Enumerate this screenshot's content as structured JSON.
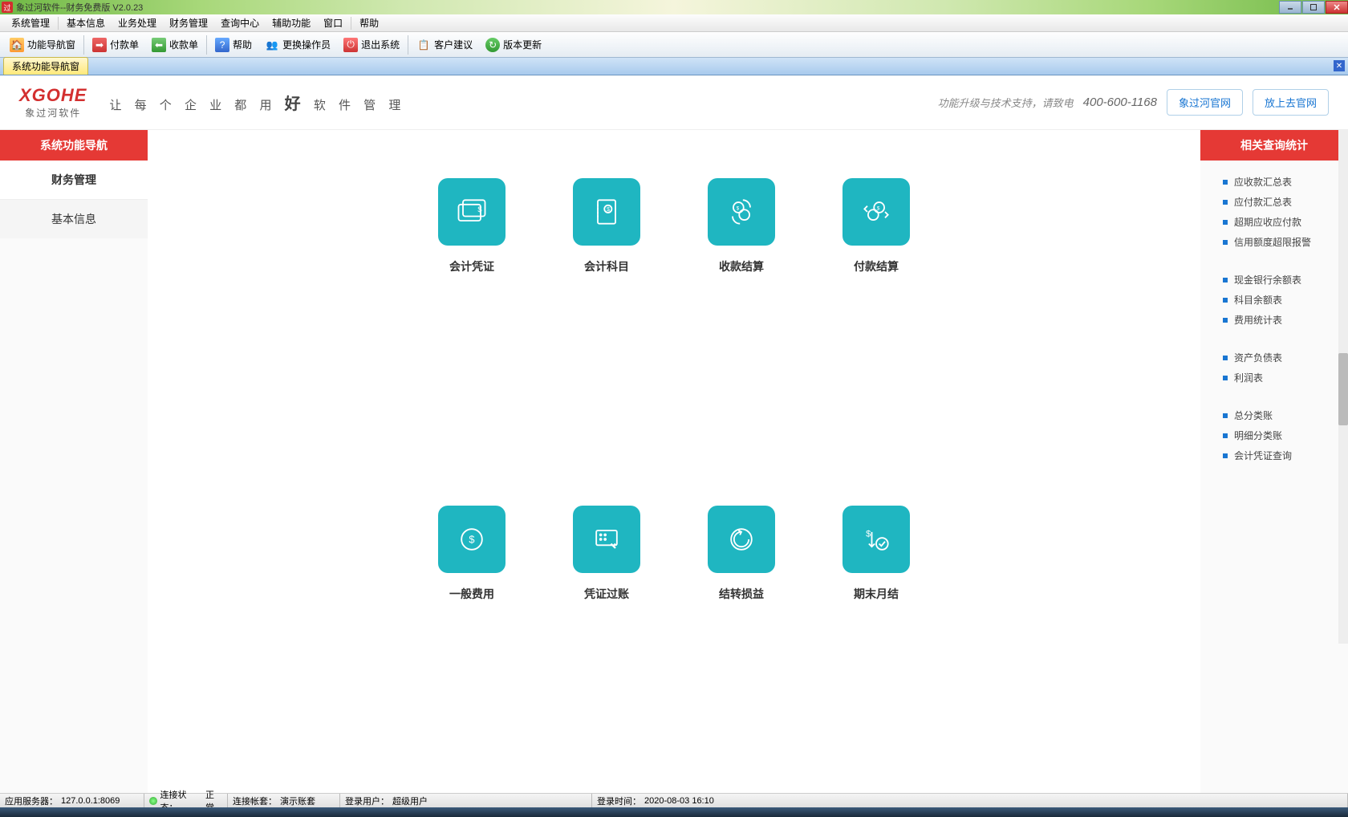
{
  "window": {
    "title": "象过河软件--财务免费版 V2.0.23"
  },
  "menubar": [
    "系统管理",
    "基本信息",
    "业务处理",
    "财务管理",
    "查询中心",
    "辅助功能",
    "窗口",
    "帮助"
  ],
  "toolbar": [
    {
      "label": "功能导航窗",
      "icon": "home"
    },
    {
      "label": "付款单",
      "icon": "pay"
    },
    {
      "label": "收款单",
      "icon": "recv"
    },
    {
      "label": "帮助",
      "icon": "help"
    },
    {
      "label": "更换操作员",
      "icon": "user"
    },
    {
      "label": "退出系统",
      "icon": "exit"
    },
    {
      "label": "客户建议",
      "icon": "note"
    },
    {
      "label": "版本更新",
      "icon": "update"
    }
  ],
  "tab": {
    "active": "系统功能导航窗"
  },
  "brand": {
    "logo": "XGOHE",
    "logo_sub": "象过河软件",
    "slogan_pre": "让 每 个 企 业 都 用",
    "slogan_big": "好",
    "slogan_post": "软 件 管 理",
    "support": "功能升级与技术支持，请致电",
    "phone": "400-600-1168",
    "btn1": "象过河官网",
    "btn2": "放上去官网"
  },
  "sidebar": {
    "header": "系统功能导航",
    "items": [
      "财务管理",
      "基本信息"
    ],
    "active_index": 0
  },
  "tiles": [
    {
      "label": "会计凭证",
      "icon": "voucher"
    },
    {
      "label": "会计科目",
      "icon": "subject"
    },
    {
      "label": "收款结算",
      "icon": "recv"
    },
    {
      "label": "付款结算",
      "icon": "pay"
    },
    {
      "label": "一般费用",
      "icon": "fee"
    },
    {
      "label": "凭证过账",
      "icon": "post"
    },
    {
      "label": "结转损益",
      "icon": "carry"
    },
    {
      "label": "期末月结",
      "icon": "month"
    }
  ],
  "rightbar": {
    "header": "相关查询统计",
    "groups": [
      [
        "应收款汇总表",
        "应付款汇总表",
        "超期应收应付款",
        "信用额度超限报警"
      ],
      [
        "现金银行余额表",
        "科目余额表",
        "费用统计表"
      ],
      [
        "资产负债表",
        "利润表"
      ],
      [
        "总分类账",
        "明细分类账",
        "会计凭证查询"
      ]
    ]
  },
  "statusbar": {
    "server_label": "应用服务器：",
    "server": "127.0.0.1:8069",
    "conn_label": "连接状态：",
    "conn": "正常",
    "acct_label": "连接帐套：",
    "acct": "演示账套",
    "user_label": "登录用户：",
    "user": "超级用户",
    "time_label": "登录时间：",
    "time": "2020-08-03 16:10"
  }
}
